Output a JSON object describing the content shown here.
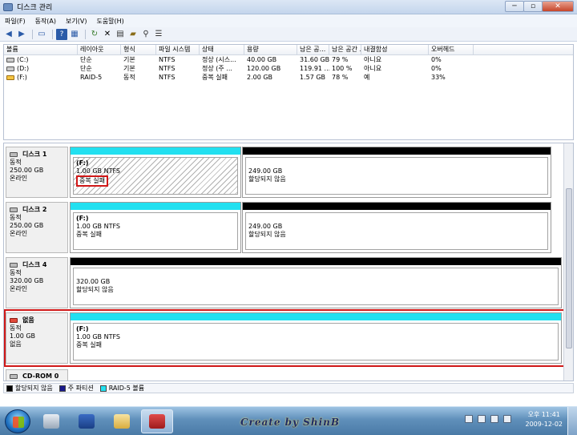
{
  "window": {
    "title": "디스크 관리",
    "minimize": "─",
    "restore": "▫",
    "close": "✕"
  },
  "menu": [
    "파일(F)",
    "동작(A)",
    "보기(V)",
    "도움말(H)"
  ],
  "toolbar": [
    "back-icon",
    "forward-icon",
    "console-icon",
    "help-icon",
    "refresh-icon",
    "delete-icon",
    "properties-icon",
    "open-icon",
    "search-icon",
    "rescan-icon"
  ],
  "volumes": {
    "headers": [
      "볼륨",
      "레이아웃",
      "형식",
      "파일 시스템",
      "상태",
      "용량",
      "남은 공...",
      "남은 공간 ...",
      "내결함성",
      "오버헤드"
    ],
    "rows": [
      {
        "volume": "(C:)",
        "layout": "단순",
        "type": "기본",
        "fs": "NTFS",
        "status": "정상 (시스...",
        "capacity": "40.00 GB",
        "free": "31.60 GB",
        "free_pct": "79 %",
        "fault": "아니요",
        "overhead": "0%",
        "warn": false
      },
      {
        "volume": "(D:)",
        "layout": "단순",
        "type": "기본",
        "fs": "NTFS",
        "status": "정상 (주 ...",
        "capacity": "120.00 GB",
        "free": "119.91 ...",
        "free_pct": "100 %",
        "fault": "아니요",
        "overhead": "0%",
        "warn": false
      },
      {
        "volume": "(F:)",
        "layout": "RAID-5",
        "type": "동적",
        "fs": "NTFS",
        "status": "중복 실패",
        "capacity": "2.00 GB",
        "free": "1.57 GB",
        "free_pct": "78 %",
        "fault": "예",
        "overhead": "33%",
        "warn": true
      }
    ]
  },
  "disks": [
    {
      "name": "디스크 1",
      "type": "동적",
      "size": "250.00 GB",
      "state": "온라인",
      "p1": {
        "letter": "(F:)",
        "size": "1.00 GB NTFS",
        "status": "중복 실패"
      },
      "p2": {
        "size": "249.00 GB",
        "status": "할당되지 않음"
      }
    },
    {
      "name": "디스크 2",
      "type": "동적",
      "size": "250.00 GB",
      "state": "온라인",
      "p1": {
        "letter": "(F:)",
        "size": "1.00 GB NTFS",
        "status": "중복 실패"
      },
      "p2": {
        "size": "249.00 GB",
        "status": "할당되지 않음"
      }
    },
    {
      "name": "디스크 4",
      "type": "동적",
      "size": "320.00 GB",
      "state": "온라인",
      "p1": {
        "size": "320.00 GB",
        "status": "할당되지 않음"
      }
    },
    {
      "name": "없음",
      "type": "동적",
      "size": "1.00 GB",
      "state": "없음",
      "p1": {
        "letter": "(F:)",
        "size": "1.00 GB NTFS",
        "status": "중복 실패"
      }
    }
  ],
  "cdrom": {
    "name": "CD-ROM 0"
  },
  "legend": [
    {
      "label": "할당되지 않음",
      "color": "#000000"
    },
    {
      "label": "주 파티션",
      "color": "#1a1a8c"
    },
    {
      "label": "RAID-5 볼륨",
      "color": "#22e0f0"
    }
  ],
  "taskbar": {
    "credit": "Create by ShinB",
    "time": "오후 11:41",
    "date": "2009-12-02"
  }
}
